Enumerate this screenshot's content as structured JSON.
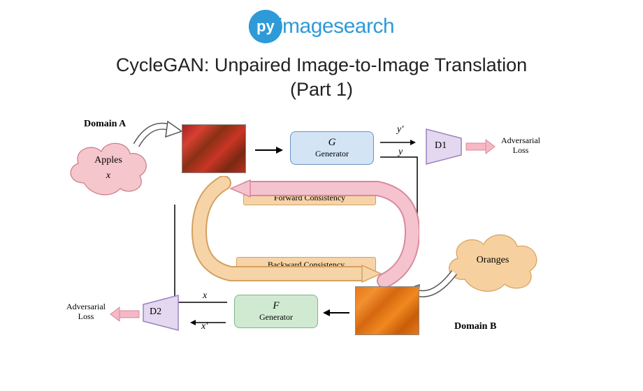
{
  "logo": {
    "py": "py",
    "rest": "imagesearch"
  },
  "title_line1": "CycleGAN: Unpaired Image-to-Image Translation",
  "title_line2": "(Part 1)",
  "domainA": {
    "title": "Domain A",
    "name": "Apples",
    "var": "x"
  },
  "domainB": {
    "title": "Domain B",
    "name": "Oranges"
  },
  "genG": {
    "sym": "G",
    "label": "Generator"
  },
  "genF": {
    "sym": "F",
    "label": "Generator"
  },
  "d1": {
    "label": "D1"
  },
  "d2": {
    "label": "D2"
  },
  "loss1": "Adversarial\nLoss",
  "loss2": "Adversarial\nLoss",
  "forward": "Forward Consistency",
  "backward": "Backward Consistency",
  "y": "y",
  "yprime": "y′",
  "x": "x",
  "xprime": "x′"
}
